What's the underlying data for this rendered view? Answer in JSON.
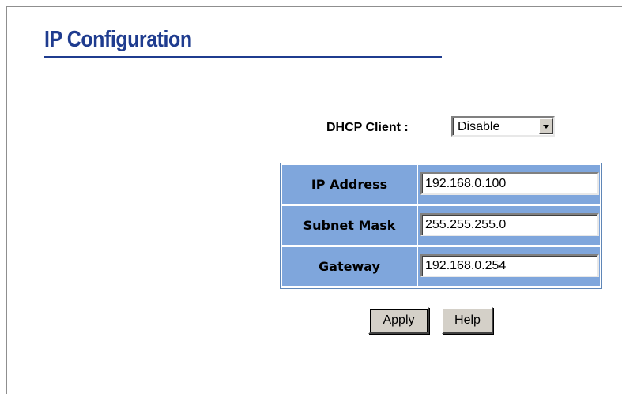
{
  "page": {
    "title": "IP Configuration"
  },
  "dhcp": {
    "label": "DHCP Client :",
    "selected": "Disable"
  },
  "ip_table": {
    "rows": [
      {
        "label": "IP Address",
        "value": "192.168.0.100"
      },
      {
        "label": "Subnet Mask",
        "value": "255.255.255.0"
      },
      {
        "label": "Gateway",
        "value": "192.168.0.254"
      }
    ]
  },
  "buttons": {
    "apply": "Apply",
    "help": "Help"
  },
  "colors": {
    "title": "#1f3c8f",
    "table_cell": "#7fa6dc",
    "button_face": "#d4d0c8"
  },
  "icons": {
    "dropdown": "chevron-down-icon"
  }
}
